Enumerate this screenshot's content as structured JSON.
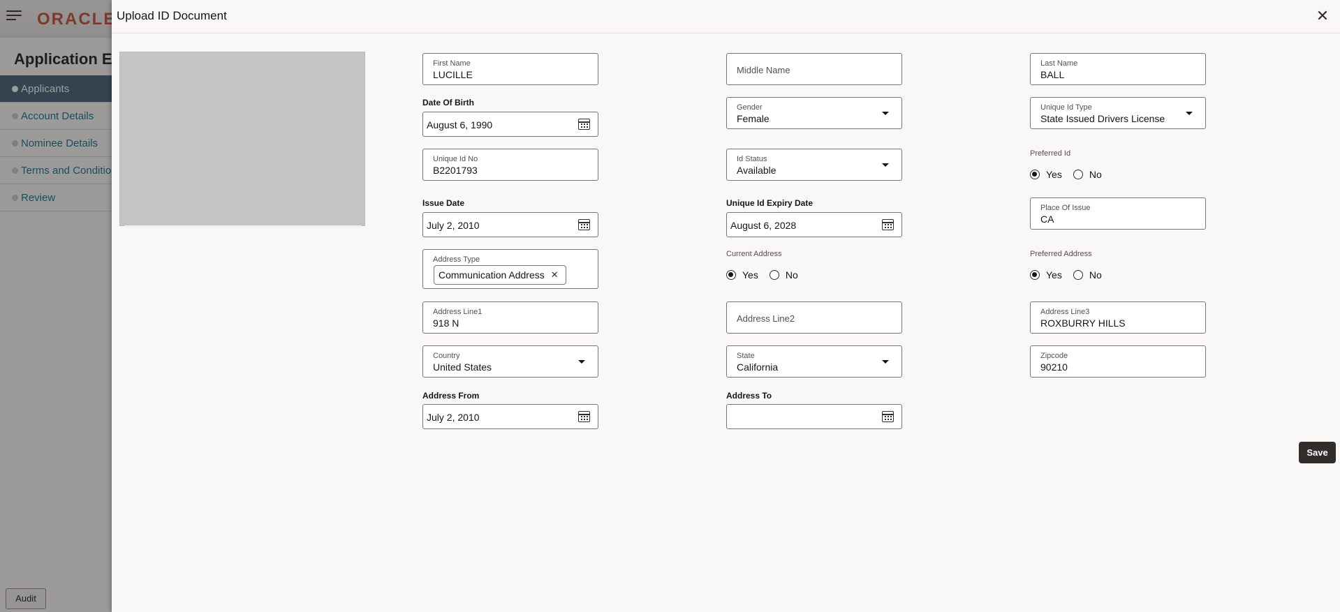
{
  "background": {
    "logo": "ORACLE",
    "title": "Application En",
    "nav": [
      {
        "label": "Applicants"
      },
      {
        "label": "Account Details"
      },
      {
        "label": "Nominee Details"
      },
      {
        "label": "Terms and Conditions"
      },
      {
        "label": "Review"
      }
    ],
    "audit_label": "Audit"
  },
  "dialog": {
    "title": "Upload ID Document",
    "save_label": "Save"
  },
  "form": {
    "first_name": {
      "label": "First Name",
      "value": "LUCILLE"
    },
    "middle_name": {
      "placeholder": "Middle Name"
    },
    "last_name": {
      "label": "Last Name",
      "value": "BALL"
    },
    "dob": {
      "label": "Date Of Birth",
      "value": "August 6, 1990"
    },
    "gender": {
      "label": "Gender",
      "value": "Female"
    },
    "unique_id_type": {
      "label": "Unique Id Type",
      "value": "State Issued Drivers License"
    },
    "unique_id_no": {
      "label": "Unique Id No",
      "value": "B2201793"
    },
    "id_status": {
      "label": "Id Status",
      "value": "Available"
    },
    "preferred_id": {
      "label": "Preferred Id",
      "yes": "Yes",
      "no": "No",
      "selected": "Yes"
    },
    "issue_date": {
      "label": "Issue Date",
      "value": "July 2, 2010"
    },
    "expiry_date": {
      "label": "Unique Id Expiry Date",
      "value": "August 6, 2028"
    },
    "place_of_issue": {
      "label": "Place Of Issue",
      "value": "CA"
    },
    "address_type": {
      "label": "Address Type",
      "tag": "Communication Address"
    },
    "current_address": {
      "label": "Current Address",
      "yes": "Yes",
      "no": "No",
      "selected": "Yes"
    },
    "preferred_address": {
      "label": "Preferred Address",
      "yes": "Yes",
      "no": "No",
      "selected": "Yes"
    },
    "address_line1": {
      "label": "Address Line1",
      "value": "918 N"
    },
    "address_line2": {
      "placeholder": "Address Line2"
    },
    "address_line3": {
      "label": "Address Line3",
      "value": "ROXBURRY HILLS"
    },
    "country": {
      "label": "Country",
      "value": "United States"
    },
    "state": {
      "label": "State",
      "value": "California"
    },
    "zipcode": {
      "label": "Zipcode",
      "value": "90210"
    },
    "address_from": {
      "label": "Address From",
      "value": "July 2, 2010"
    },
    "address_to": {
      "label": "Address To",
      "value": ""
    }
  }
}
